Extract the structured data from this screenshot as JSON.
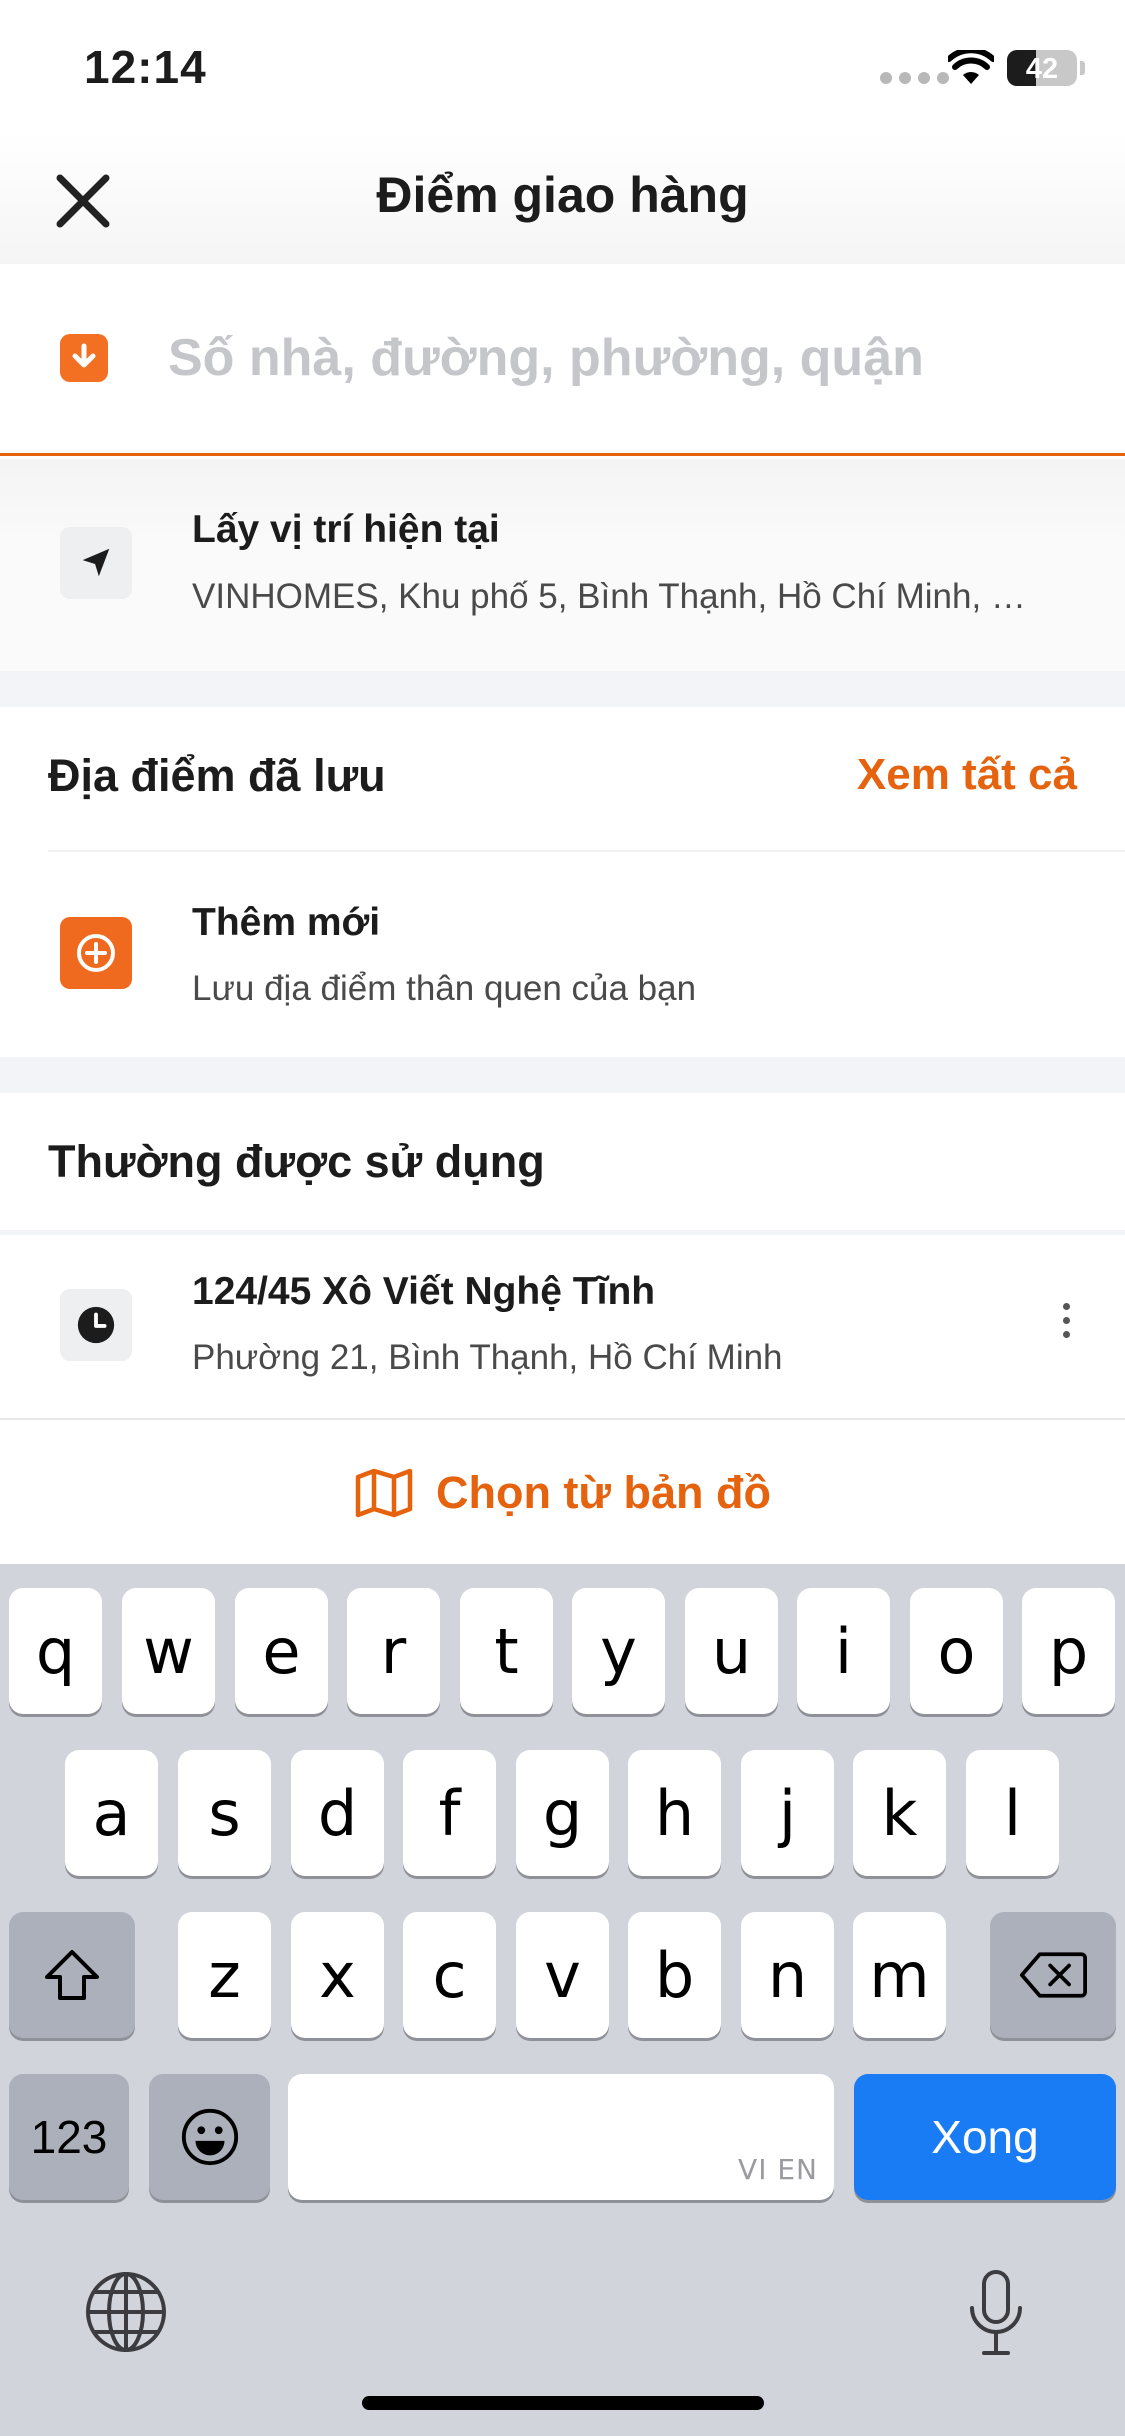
{
  "status_bar": {
    "time": "12:14",
    "battery": "42",
    "battery_level": 0.42
  },
  "header": {
    "title": "Điểm giao hàng"
  },
  "search": {
    "placeholder": "Số nhà, đường, phường, quận",
    "value": ""
  },
  "current_location": {
    "title": "Lấy vị trí hiện tại",
    "address": "VINHOMES, Khu phố 5, Bình Thạnh, Hồ Chí Minh, Việt Nam"
  },
  "saved_places": {
    "title": "Địa điểm đã lưu",
    "see_all": "Xem tất cả",
    "add_new": {
      "title": "Thêm mới",
      "subtitle": "Lưu địa điểm thân quen của bạn"
    }
  },
  "frequently_used": {
    "title": "Thường được sử dụng",
    "items": [
      {
        "title": "124/45 Xô Viết Nghệ Tĩnh",
        "subtitle": "Phường 21, Bình Thạnh, Hồ Chí Minh"
      }
    ]
  },
  "map_button": {
    "label": "Chọn từ bản đồ"
  },
  "keyboard": {
    "row1": [
      "q",
      "w",
      "e",
      "r",
      "t",
      "y",
      "u",
      "i",
      "o",
      "p"
    ],
    "row2": [
      "a",
      "s",
      "d",
      "f",
      "g",
      "h",
      "j",
      "k",
      "l"
    ],
    "row3": [
      "z",
      "x",
      "c",
      "v",
      "b",
      "n",
      "m"
    ],
    "numbers_key": "123",
    "space_hint": "VI EN",
    "done_key": "Xong"
  },
  "colors": {
    "accent": "#e5630f",
    "keyboard_bg": "#d1d4db",
    "done_key": "#1a7cf5"
  },
  "icons": [
    "close-icon",
    "download-pin-icon",
    "navigation-arrow-icon",
    "plus-circle-icon",
    "clock-icon",
    "more-vertical-icon",
    "map-icon",
    "shift-icon",
    "backspace-icon",
    "emoji-icon",
    "globe-icon",
    "microphone-icon",
    "wifi-icon"
  ]
}
